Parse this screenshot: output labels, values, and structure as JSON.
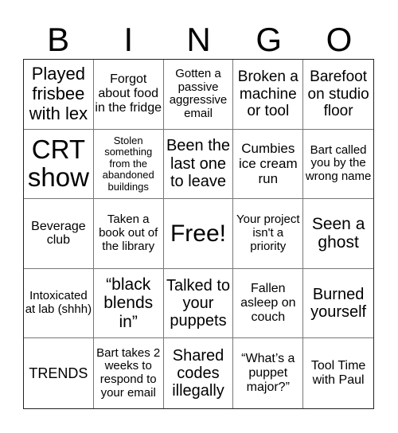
{
  "header": {
    "letters": [
      "B",
      "I",
      "N",
      "G",
      "O"
    ]
  },
  "cells": [
    "Played frisbee with lex",
    "Forgot about food in the fridge",
    "Gotten a passive aggressive email",
    "Broken a machine or tool",
    "Barefoot on studio floor",
    "CRT show",
    "Stolen something from the abandoned buildings",
    "Been the last one to leave",
    "Cumbies ice cream run",
    "Bart called you by the wrong name",
    "Beverage club",
    "Taken a book out of the library",
    "Free!",
    "Your project isn't a priority",
    "Seen a ghost",
    "Intoxicated at lab (shhh)",
    "“black blends in”",
    "Talked to your puppets",
    "Fallen asleep on couch",
    "Burned yourself",
    "TRENDS",
    "Bart takes 2 weeks to respond to your email",
    "Shared codes illegally",
    "“What’s a puppet major?”",
    "Tool Time with Paul"
  ]
}
